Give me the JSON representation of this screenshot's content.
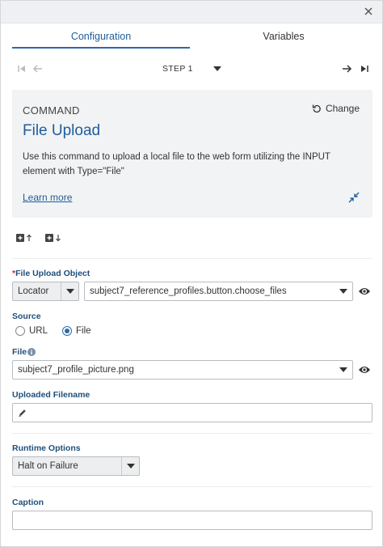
{
  "tabs": {
    "configuration": "Configuration",
    "variables": "Variables"
  },
  "step": {
    "label": "STEP 1"
  },
  "command": {
    "header": "COMMAND",
    "change_label": "Change",
    "title": "File Upload",
    "description": "Use this command to upload a local file to the web form utilizing the INPUT element with Type=\"File\"",
    "learn_more": "Learn more"
  },
  "form": {
    "file_upload_object": {
      "required_mark": "*",
      "label": "File Upload Object",
      "locator_type": "Locator",
      "locator_value": "subject7_reference_profiles.button.choose_files"
    },
    "source": {
      "label": "Source",
      "options": [
        "URL",
        "File"
      ],
      "selected": "File"
    },
    "file": {
      "label": "File",
      "value": "subject7_profile_picture.png"
    },
    "uploaded_filename": {
      "label": "Uploaded Filename",
      "value": ""
    },
    "runtime_options": {
      "label": "Runtime Options",
      "value": "Halt on Failure"
    },
    "caption": {
      "label": "Caption",
      "value": ""
    }
  },
  "icons": {
    "close": "close-icon",
    "first": "first-step-icon",
    "prev": "prev-step-icon",
    "next": "next-step-icon",
    "last": "last-step-icon",
    "undo": "undo-icon",
    "collapse": "collapse-icon",
    "insert_above": "insert-above-icon",
    "insert_below": "insert-below-icon",
    "eye": "eye-icon",
    "info": "info-icon",
    "pencil": "pencil-icon"
  },
  "colors": {
    "accent": "#1f5d99",
    "card_bg": "#f2f3f4",
    "required": "#dd2233"
  }
}
